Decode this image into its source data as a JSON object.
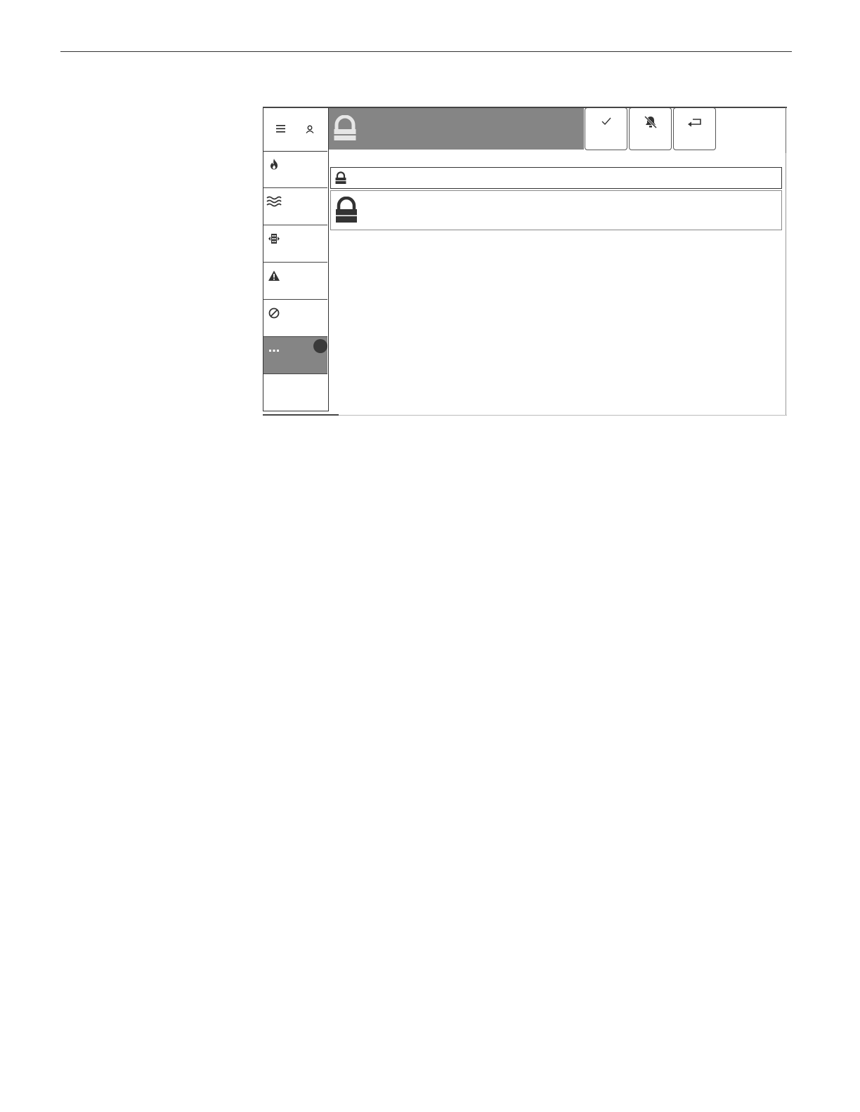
{
  "header": {
    "title_icon": "lock-icon",
    "buttons": [
      {
        "icon": "check-icon"
      },
      {
        "icon": "bell-off-icon"
      },
      {
        "icon": "return-icon"
      }
    ]
  },
  "sidebar": {
    "head_icons": [
      "menu-icon",
      "user-icon"
    ],
    "items": [
      {
        "icon": "fire-icon",
        "active": false
      },
      {
        "icon": "waves-icon",
        "active": false
      },
      {
        "icon": "building-icon",
        "active": false
      },
      {
        "icon": "warning-icon",
        "active": false
      },
      {
        "icon": "disabled-icon",
        "active": false
      },
      {
        "icon": "more-icon",
        "active": true,
        "badge": true
      },
      {
        "icon": "",
        "active": false
      }
    ]
  },
  "content": {
    "rows": [
      {
        "icon": "lock-icon",
        "size": "small"
      },
      {
        "icon": "lock-icon",
        "size": "large"
      }
    ]
  },
  "colors": {
    "header_bg": "#858585",
    "active_bg": "#858585",
    "badge": "#3a3a3a",
    "line": "#333333"
  }
}
